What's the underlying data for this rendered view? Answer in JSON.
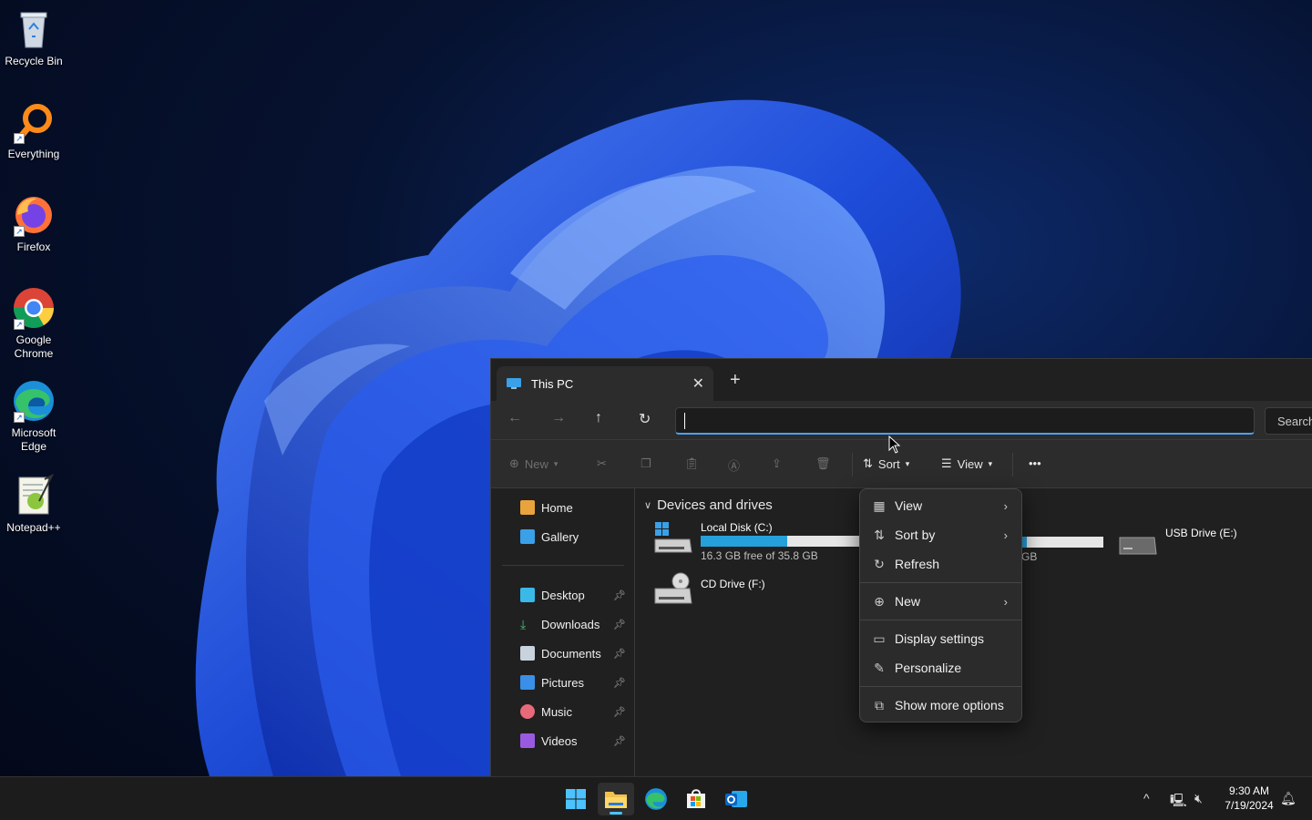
{
  "desktop": {
    "icons": [
      {
        "label": "Recycle Bin"
      },
      {
        "label": "Everything"
      },
      {
        "label": "Firefox"
      },
      {
        "label": "Google Chrome"
      },
      {
        "label": "Microsoft Edge"
      },
      {
        "label": "Notepad++"
      }
    ]
  },
  "explorer": {
    "tab_title": "This PC",
    "tab_close": "✕",
    "new_tab": "+",
    "address_value": "",
    "search_placeholder": "Search",
    "commands": {
      "new": "New",
      "sort": "Sort",
      "view": "View",
      "more": "•••"
    },
    "sidebar": {
      "top": [
        {
          "label": "Home"
        },
        {
          "label": "Gallery"
        }
      ],
      "pinned": [
        {
          "label": "Desktop"
        },
        {
          "label": "Downloads"
        },
        {
          "label": "Documents"
        },
        {
          "label": "Pictures"
        },
        {
          "label": "Music"
        },
        {
          "label": "Videos"
        }
      ]
    },
    "section_title": "Devices and drives",
    "drives": [
      {
        "name": "Local Disk (C:)",
        "free": "16.3 GB free of 35.8 GB",
        "used_fraction": 0.545
      },
      {
        "name": "CD Drive (F:)"
      },
      {
        "partial_free": "GB"
      },
      {
        "name": "USB Drive (E:)"
      }
    ]
  },
  "context_menu": {
    "items": [
      {
        "label": "View",
        "icon": "grid-icon",
        "submenu": true
      },
      {
        "label": "Sort by",
        "icon": "sort-icon",
        "submenu": true
      },
      {
        "label": "Refresh",
        "icon": "refresh-icon"
      },
      {
        "label": "New",
        "icon": "plus-circle-icon",
        "submenu": true
      },
      {
        "label": "Display settings",
        "icon": "display-icon"
      },
      {
        "label": "Personalize",
        "icon": "brush-icon"
      },
      {
        "label": "Show more options",
        "icon": "expand-icon"
      }
    ]
  },
  "taskbar": {
    "time": "9:30 AM",
    "date": "7/19/2024"
  },
  "colors": {
    "accent": "#4cc2ff",
    "drive_fill": "#26a0da",
    "window_bg": "#202020",
    "menu_bg": "#2b2b2b"
  }
}
